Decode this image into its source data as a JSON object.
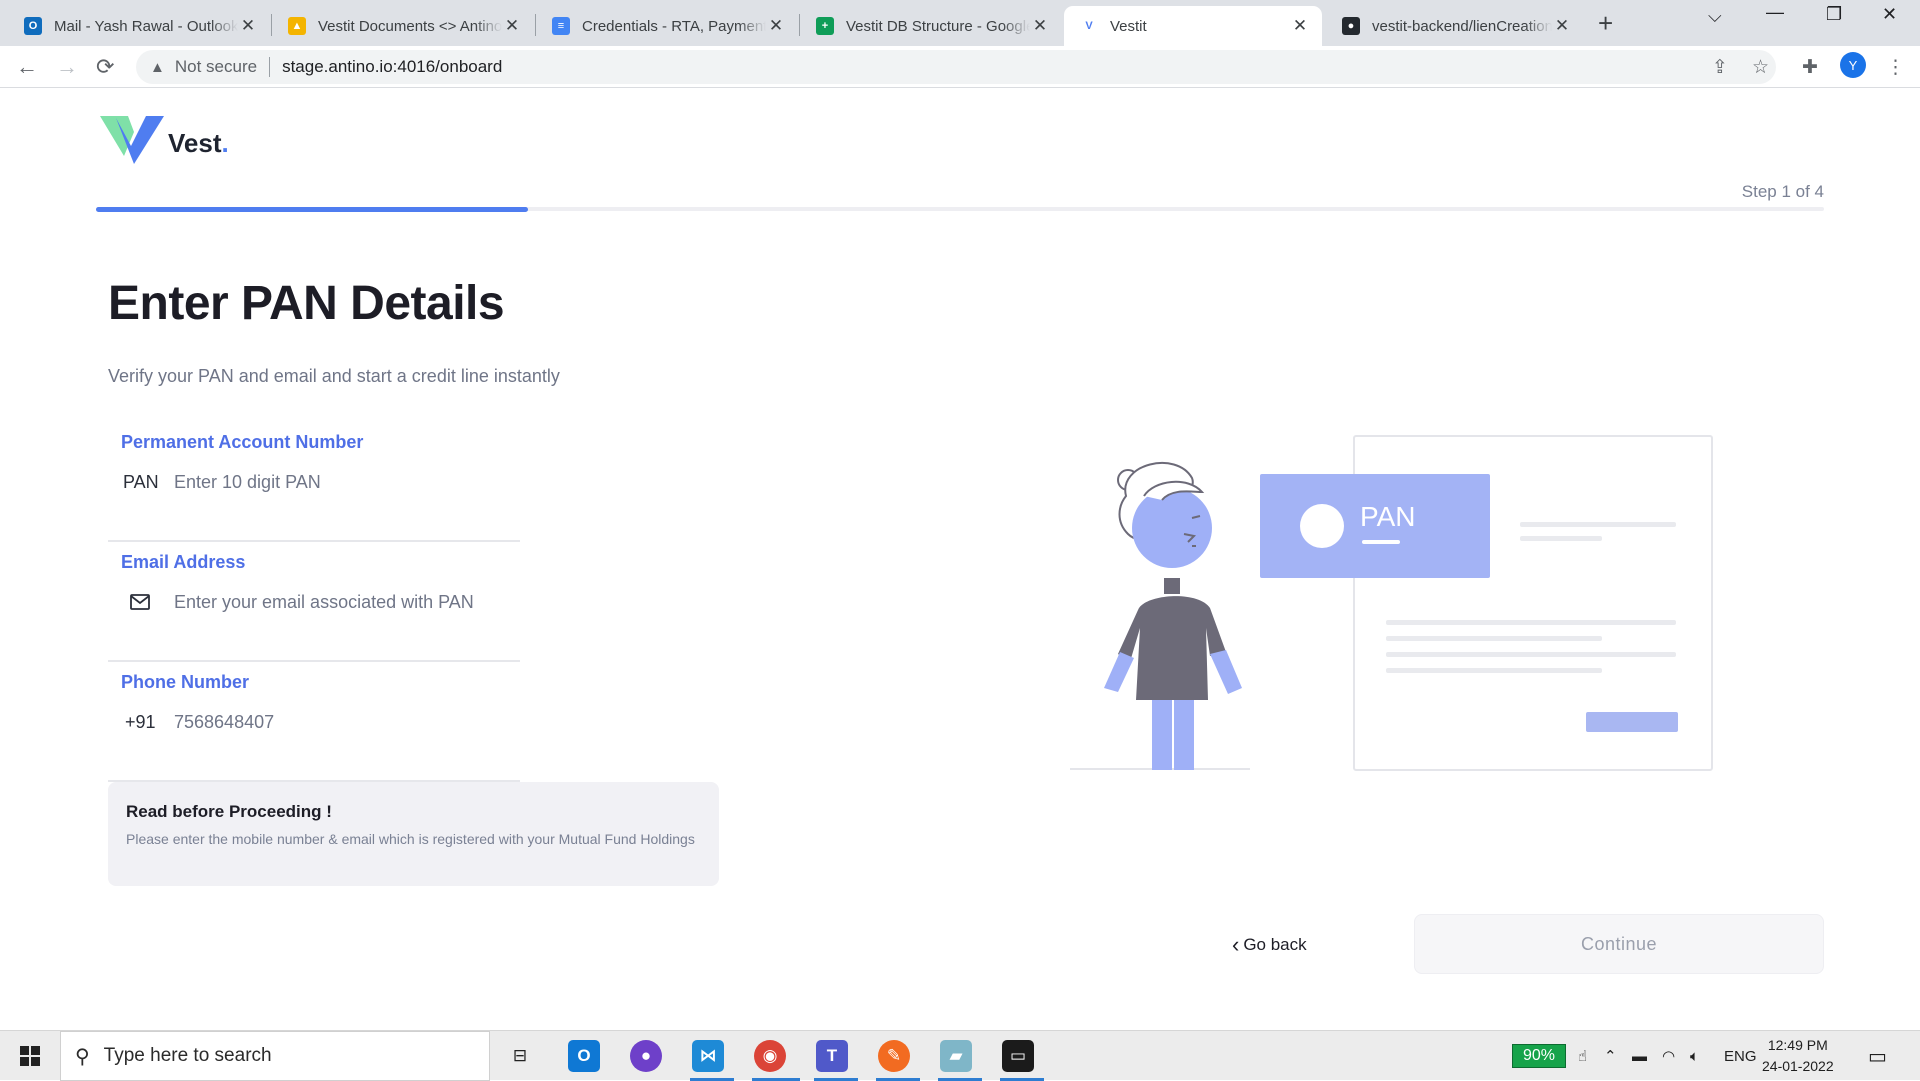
{
  "browser": {
    "tabs": [
      {
        "title": "Mail - Yash Rawal - Outlook",
        "color": "#0f6cbd",
        "glyph": "O",
        "icon": "outlook-icon"
      },
      {
        "title": "Vestit Documents <> Antino",
        "color": "#f4b400",
        "glyph": "▲",
        "icon": "google-drive-icon"
      },
      {
        "title": "Credentials - RTA, Payment",
        "color": "#4285f4",
        "glyph": "≡",
        "icon": "google-docs-icon"
      },
      {
        "title": "Vestit DB Structure - Google",
        "color": "#0f9d58",
        "glyph": "+",
        "icon": "google-sheets-icon"
      },
      {
        "title": "Vestit",
        "color": "#4f7df0",
        "glyph": "V",
        "icon": "vestit-favicon-icon"
      },
      {
        "title": "vestit-backend/lienCreation",
        "color": "#24292f",
        "glyph": "●",
        "icon": "github-icon"
      }
    ],
    "not_secure": "Not secure",
    "url": "stage.antino.io:4016/onboard",
    "profile_initial": "Y"
  },
  "page": {
    "brand": "Vest",
    "brand_dot": ".",
    "step": "Step 1 of 4",
    "progress": 0.25,
    "title": "Enter PAN Details",
    "subtitle": "Verify your PAN and email and start a credit line instantly",
    "pan": {
      "label": "Permanent Account Number",
      "prefix": "PAN",
      "placeholder": "Enter 10 digit PAN",
      "value": ""
    },
    "email": {
      "label": "Email Address",
      "placeholder": "Enter your email associated with PAN",
      "value": ""
    },
    "phone": {
      "label": "Phone Number",
      "prefix": "+91",
      "value": "7568648407"
    },
    "notice": {
      "title": "Read before Proceeding !",
      "body": "Please enter the mobile number & email which is registered with your Mutual Fund Holdings"
    },
    "illustration_card_text": "PAN",
    "go_back": "Go back",
    "continue": "Continue",
    "colors": {
      "accent": "#4f7df0",
      "illustration": "#9fb0f7",
      "figure": "#6c6a78"
    }
  },
  "taskbar": {
    "search_placeholder": "Type here to search",
    "battery": "90%",
    "language": "ENG",
    "time": "12:49 PM",
    "date": "24-01-2022"
  }
}
